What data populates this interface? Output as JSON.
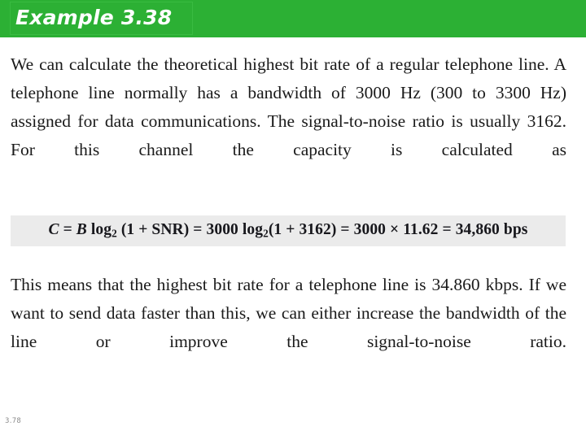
{
  "slide": {
    "title": "Example 3.38",
    "banner_color": "#2cb034",
    "title_color": "#ffffff",
    "page_number": "3.78"
  },
  "body": {
    "paragraph_1": "We can calculate the theoretical highest bit rate of a regular telephone line. A telephone line normally has a bandwidth of 3000 Hz (300 to 3300 Hz) assigned for data communications. The signal-to-noise ratio is usually 3162. For this channel the capacity is calculated as",
    "paragraph_2": "This means that the highest bit rate for a telephone line is 34.860 kbps. If we want to send data faster than this, we can either increase the bandwidth of the line or improve the signal-to-noise ratio."
  },
  "formula": {
    "background_color": "#ebebeb",
    "parts": {
      "capacity_symbol": "C",
      "equals_1": " = ",
      "bandwidth_symbol": "B",
      "log_1": " log",
      "log_base_1": "2",
      "snr_term": " (1 + SNR)",
      "equals_2": " = ",
      "bandwidth_value": "3000",
      "log_2": " log",
      "log_base_2": "2",
      "snr_value": "(1 + 3162)",
      "equals_3": " = ",
      "bandwidth_value_2": "3000",
      "times": " × ",
      "log_result": "11.62",
      "equals_4": " = ",
      "result": "34,860 bps"
    },
    "plain_text": "C = B log2 (1 + SNR) = 3000 log2(1 + 3162) = 3000 × 11.62 = 34,860 bps"
  }
}
